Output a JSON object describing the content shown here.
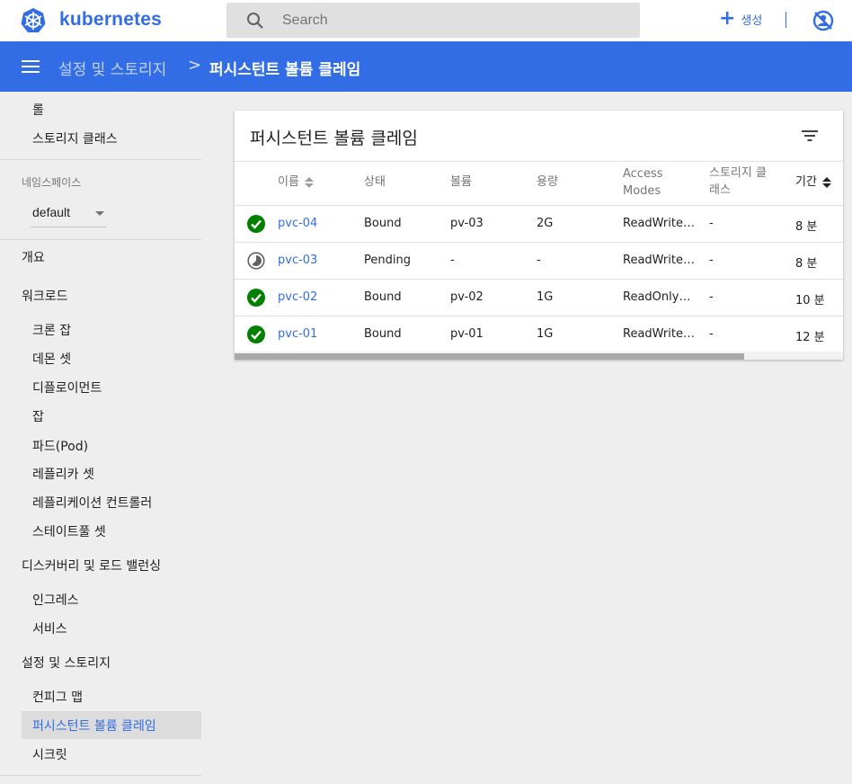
{
  "header": {
    "brand": "kubernetes",
    "search_placeholder": "Search",
    "create_label": "생성"
  },
  "breadcrumb": {
    "parent": "설정 및 스토리지",
    "separator": ">",
    "current": "퍼시스턴트 볼륨 클레임"
  },
  "sidebar": {
    "top_items": [
      "롤",
      "스토리지 클래스"
    ],
    "namespace_label": "네임스페이스",
    "namespace_value": "default",
    "overview": "개요",
    "workloads": {
      "title": "워크로드",
      "items": [
        "크론 잡",
        "데몬 셋",
        "디플로이먼트",
        "잡",
        "파드(Pod)",
        "레플리카 셋",
        "레플리케이션 컨트롤러",
        "스테이트풀 셋"
      ]
    },
    "discovery": {
      "title": "디스커버리 및 로드 밸런싱",
      "items": [
        "인그레스",
        "서비스"
      ]
    },
    "config": {
      "title": "설정 및 스토리지",
      "items": [
        "컨피그 맵",
        "퍼시스턴트 볼륨 클레임",
        "시크릿"
      ],
      "active_index": 1
    }
  },
  "card": {
    "title": "퍼시스턴트 볼륨 클레임",
    "columns": {
      "name": "이름",
      "status": "상태",
      "volume": "볼륨",
      "capacity": "용량",
      "access_line1": "Access",
      "access_line2": "Modes",
      "storage_line1": "스토리지 클",
      "storage_line2": "래스",
      "age": "기간"
    },
    "rows": [
      {
        "status_icon": "check-circle-icon",
        "name": "pvc-04",
        "status": "Bound",
        "volume": "pv-03",
        "capacity": "2G",
        "access": "ReadWrite…",
        "storage_class": "-",
        "age": "8 분"
      },
      {
        "status_icon": "pending-icon",
        "name": "pvc-03",
        "status": "Pending",
        "volume": "-",
        "capacity": "-",
        "access": "ReadWrite…",
        "storage_class": "-",
        "age": "8 분"
      },
      {
        "status_icon": "check-circle-icon",
        "name": "pvc-02",
        "status": "Bound",
        "volume": "pv-02",
        "capacity": "1G",
        "access": "ReadOnly…",
        "storage_class": "-",
        "age": "10 분"
      },
      {
        "status_icon": "check-circle-icon",
        "name": "pvc-01",
        "status": "Bound",
        "volume": "pv-01",
        "capacity": "1G",
        "access": "ReadWrite…",
        "storage_class": "-",
        "age": "12 분"
      }
    ]
  },
  "colors": {
    "accent": "#326de6",
    "success": "#008000",
    "sidebar_active_bg": "#dcdcdc"
  }
}
